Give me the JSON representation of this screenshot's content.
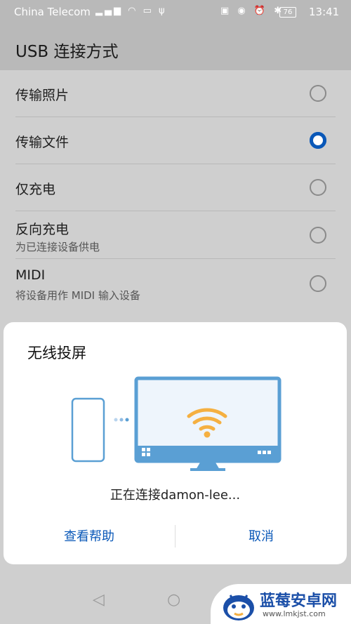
{
  "status_bar": {
    "carrier": "China Telecom",
    "battery": "76",
    "time": "13:41"
  },
  "header": {
    "title": "USB 连接方式"
  },
  "options": [
    {
      "label": "传输照片",
      "sub": "",
      "selected": false
    },
    {
      "label": "传输文件",
      "sub": "",
      "selected": true
    },
    {
      "label": "仅充电",
      "sub": "",
      "selected": false
    },
    {
      "label": "反向充电",
      "sub": "为已连接设备供电",
      "selected": false
    },
    {
      "label": "MIDI",
      "sub": "将设备用作 MIDI 输入设备",
      "selected": false
    }
  ],
  "dialog": {
    "title": "无线投屏",
    "status": "正在连接damon-lee...",
    "help_label": "查看帮助",
    "cancel_label": "取消"
  },
  "watermark": {
    "text": "蓝莓安卓网",
    "url": "www.lmkjst.com"
  },
  "colors": {
    "accent": "#0a58b8",
    "wifi": "#f5b041",
    "monitor": "#5a9fd4"
  }
}
